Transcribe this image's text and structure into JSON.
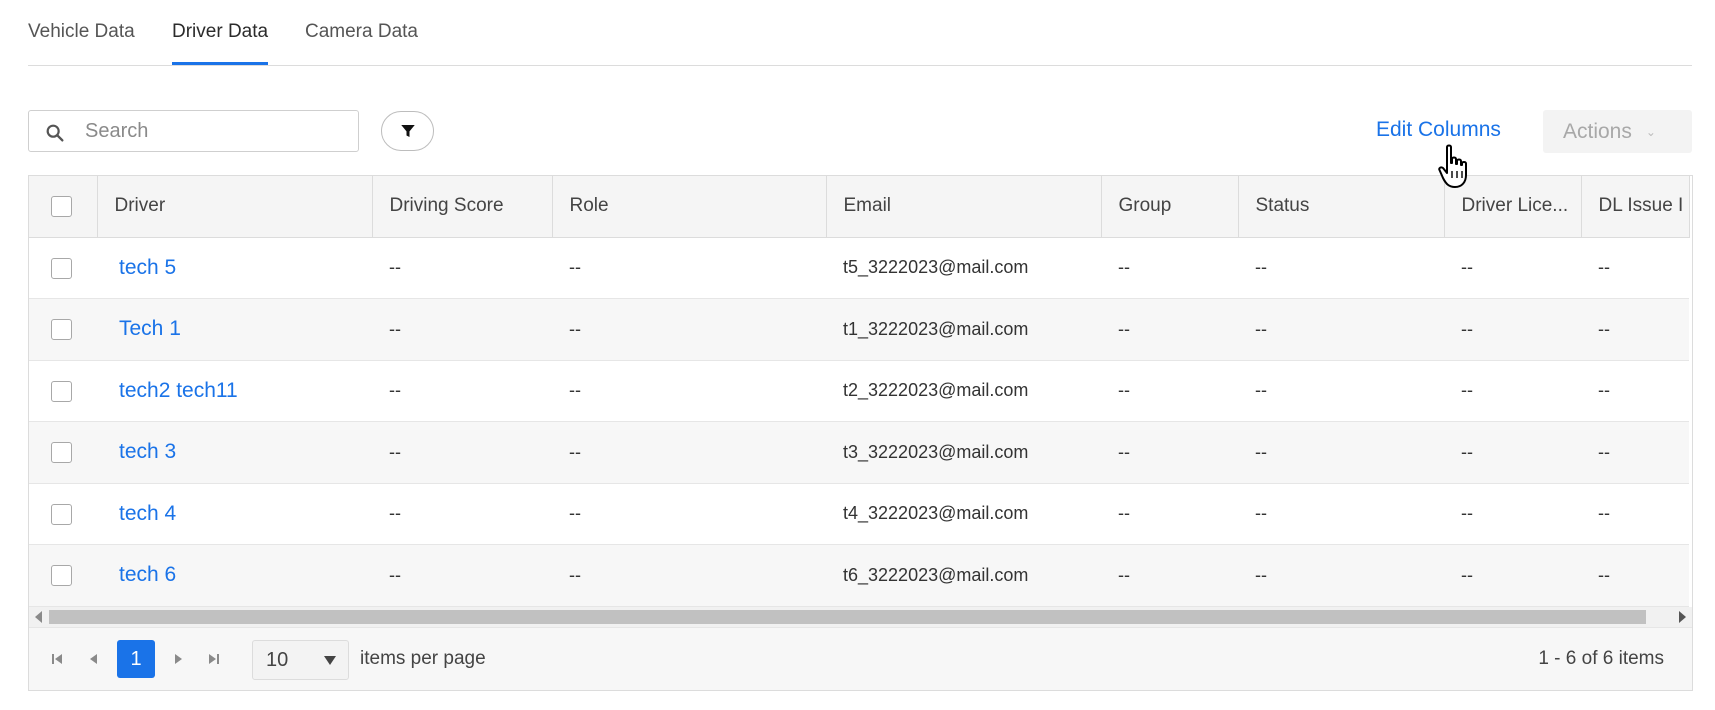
{
  "tabs": [
    {
      "label": "Vehicle Data",
      "active": false
    },
    {
      "label": "Driver Data",
      "active": true
    },
    {
      "label": "Camera Data",
      "active": false
    }
  ],
  "toolbar": {
    "search_placeholder": "Search",
    "search_value": "",
    "edit_columns_label": "Edit Columns",
    "actions_label": "Actions"
  },
  "table": {
    "headers": [
      "Driver",
      "Driving Score",
      "Role",
      "Email",
      "Group",
      "Status",
      "Driver Lice...",
      "DL Issue I"
    ],
    "rows": [
      {
        "driver": "tech 5",
        "driving_score": "--",
        "role": "--",
        "email": "t5_3222023@mail.com",
        "group": "--",
        "status": "--",
        "license": "--",
        "dl_issue": "--"
      },
      {
        "driver": "Tech 1",
        "driving_score": "--",
        "role": "--",
        "email": "t1_3222023@mail.com",
        "group": "--",
        "status": "--",
        "license": "--",
        "dl_issue": "--"
      },
      {
        "driver": "tech2 tech11",
        "driving_score": "--",
        "role": "--",
        "email": "t2_3222023@mail.com",
        "group": "--",
        "status": "--",
        "license": "--",
        "dl_issue": "--"
      },
      {
        "driver": "tech 3",
        "driving_score": "--",
        "role": "--",
        "email": "t3_3222023@mail.com",
        "group": "--",
        "status": "--",
        "license": "--",
        "dl_issue": "--"
      },
      {
        "driver": "tech 4",
        "driving_score": "--",
        "role": "--",
        "email": "t4_3222023@mail.com",
        "group": "--",
        "status": "--",
        "license": "--",
        "dl_issue": "--"
      },
      {
        "driver": "tech 6",
        "driving_score": "--",
        "role": "--",
        "email": "t6_3222023@mail.com",
        "group": "--",
        "status": "--",
        "license": "--",
        "dl_issue": "--"
      }
    ]
  },
  "pager": {
    "current_page": "1",
    "page_size": "10",
    "items_per_page_label": "items per page",
    "summary": "1 - 6 of 6 items"
  },
  "colors": {
    "accent": "#1a73e8",
    "header_bg": "#f5f5f5",
    "alt_row_bg": "#f7f7f7"
  },
  "icons": [
    "search-icon",
    "filter-funnel-icon",
    "chevron-down-icon",
    "hand-pointer-cursor-icon",
    "first-page-icon",
    "previous-page-icon",
    "next-page-icon",
    "last-page-icon"
  ]
}
